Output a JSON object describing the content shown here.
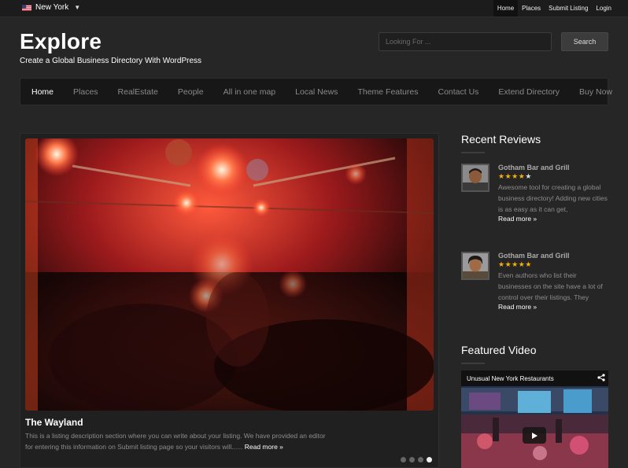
{
  "topbar": {
    "city": "New York",
    "links": [
      "Home",
      "Places",
      "Submit Listing",
      "Login"
    ]
  },
  "header": {
    "title": "Explore",
    "tagline": "Create a Global Business Directory With WordPress",
    "search_placeholder": "Looking For ...",
    "search_button": "Search"
  },
  "nav": {
    "items": [
      "Home",
      "Places",
      "RealEstate",
      "People",
      "All in one map",
      "Local News",
      "Theme Features",
      "Contact Us",
      "Extend Directory",
      "Buy Now"
    ],
    "active": "Home"
  },
  "slider": {
    "listing_title": "The Wayland",
    "listing_desc": "This is a listing description section where you can write about your listing. We have provided an editor for entering this information on Submit listing page so your visitors will......",
    "read_more": "Read more »",
    "slide_count": 4,
    "active_slide": 4
  },
  "sidebar": {
    "reviews_heading": "Recent Reviews",
    "reviews": [
      {
        "name": "Gotham Bar and Grill",
        "rating": 4,
        "text": "Awesome tool for creating a global business directory! Adding new cities is as easy as it can get,",
        "more": "Read more »"
      },
      {
        "name": "Gotham Bar and Grill",
        "rating": 5,
        "text": "Even authors who list their businesses on the site have a lot of control over their listings. They",
        "more": "Read more »"
      }
    ],
    "video_heading": "Featured Video",
    "video_title": "Unusual New York Restaurants"
  },
  "colors": {
    "background": "#262626",
    "star": "#f5b300",
    "nav_active": "#ffffff"
  },
  "icons": {
    "flag": "us-flag-icon",
    "dropdown": "chevron-down-icon",
    "share": "share-icon",
    "play": "play-icon",
    "star": "star-icon"
  }
}
